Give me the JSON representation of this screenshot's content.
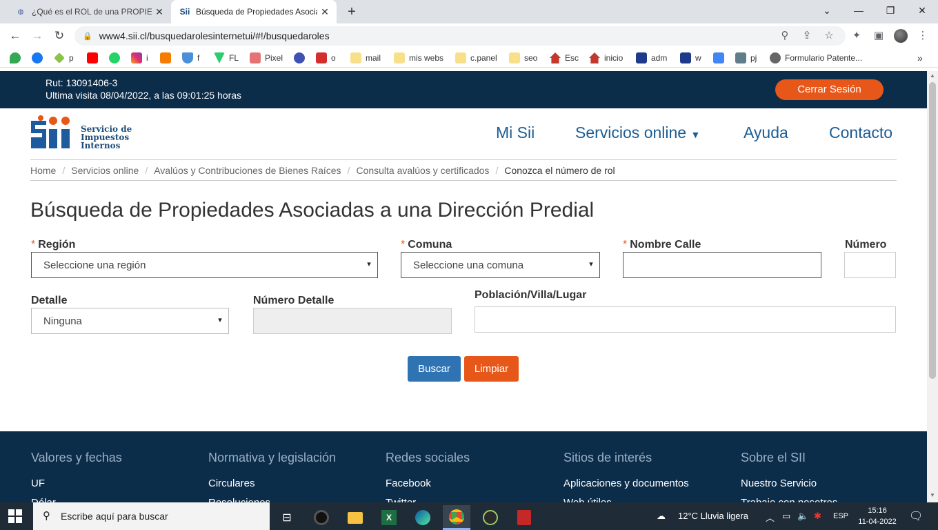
{
  "browser": {
    "tabs": [
      {
        "title": "¿Qué es el ROL de una PROPIEDAD",
        "active": false
      },
      {
        "title": "Búsqueda de Propiedades Asociad",
        "active": true
      }
    ],
    "url": "www4.sii.cl/busquedarolesinternetui/#!/busquedaroles",
    "bookmarks": [
      "p",
      "i",
      "f",
      "FL",
      "Pixel",
      "o",
      "mail",
      "mis webs",
      "c.panel",
      "seo",
      "Esc",
      "inicio",
      "adm",
      "w",
      "pj",
      "Formulario Patente..."
    ],
    "overflow": "»"
  },
  "header": {
    "rut": "Rut: 13091406-3",
    "last_visit": "Ultima visita 08/04/2022, a las 09:01:25 horas",
    "logout": "Cerrar Sesión",
    "logo_lines": [
      "Servicio de",
      "Impuestos",
      "Internos"
    ],
    "nav": [
      "Mi Sii",
      "Servicios online",
      "Ayuda",
      "Contacto"
    ]
  },
  "breadcrumb": [
    "Home",
    "Servicios online",
    "Avalúos y Contribuciones de Bienes Raíces",
    "Consulta avalúos y certificados",
    "Conozca el número de rol"
  ],
  "form": {
    "title": "Búsqueda de Propiedades Asociadas a una Dirección Predial",
    "region_label": "Región",
    "region_value": "Seleccione una región",
    "comuna_label": "Comuna",
    "comuna_value": "Seleccione una comuna",
    "calle_label": "Nombre Calle",
    "numero_label": "Número",
    "detalle_label": "Detalle",
    "detalle_value": "Ninguna",
    "numero_detalle_label": "Número Detalle",
    "poblacion_label": "Población/Villa/Lugar",
    "required_mark": "*",
    "search_button": "Buscar",
    "clear_button": "Limpiar"
  },
  "footer": {
    "columns": [
      {
        "heading": "Valores y fechas",
        "links": [
          "UF",
          "Dólar"
        ]
      },
      {
        "heading": "Normativa y legislación",
        "links": [
          "Circulares",
          "Resoluciones"
        ]
      },
      {
        "heading": "Redes sociales",
        "links": [
          "Facebook",
          "Twitter"
        ]
      },
      {
        "heading": "Sitios de interés",
        "links": [
          "Aplicaciones y documentos",
          "Web útiles"
        ]
      },
      {
        "heading": "Sobre el SII",
        "links": [
          "Nuestro Servicio",
          "Trabaje con nosotros"
        ]
      }
    ]
  },
  "taskbar": {
    "search_placeholder": "Escribe aquí para buscar",
    "weather": "12°C  Lluvia ligera",
    "language": "ESP",
    "time": "15:16",
    "date": "11-04-2022"
  },
  "colors": {
    "navy": "#0c2d4a",
    "orange": "#e8571a",
    "blue": "#2f73b3",
    "link_blue": "#1a5c93"
  }
}
